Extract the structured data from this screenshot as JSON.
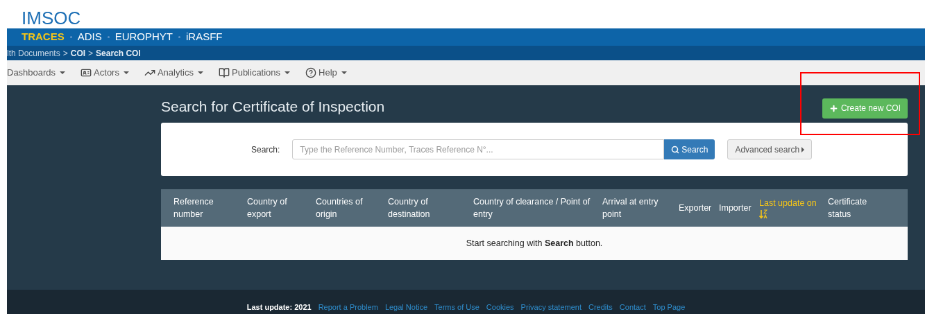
{
  "brand": "IMSOC",
  "apps": [
    {
      "label": "TRACES",
      "selected": true
    },
    {
      "label": "ADIS",
      "selected": false
    },
    {
      "label": "EUROPHYT",
      "selected": false
    },
    {
      "label": "iRASFF",
      "selected": false
    }
  ],
  "breadcrumb": {
    "separator": ">",
    "items": [
      {
        "label": "lth Documents",
        "bold": false
      },
      {
        "label": "COI",
        "bold": true
      },
      {
        "label": "Search COI",
        "bold": true
      }
    ]
  },
  "menu": [
    {
      "label": "Dashboards",
      "kind": "plain"
    },
    {
      "label": "Actors",
      "kind": "card"
    },
    {
      "label": "Analytics",
      "kind": "chart"
    },
    {
      "label": "Publications",
      "kind": "book"
    },
    {
      "label": "Help",
      "kind": "question"
    }
  ],
  "page_title": "Search for Certificate of Inspection",
  "create_button": "Create new COI",
  "search": {
    "label": "Search:",
    "placeholder": "Type the Reference Number, Traces Reference N°...",
    "button": "Search",
    "advanced": "Advanced search"
  },
  "table": {
    "columns": [
      {
        "label": "Reference number",
        "sorted": false
      },
      {
        "label": "Country of export",
        "sorted": false
      },
      {
        "label": "Countries of origin",
        "sorted": false
      },
      {
        "label": "Country of destination",
        "sorted": false
      },
      {
        "label": "Country of clearance / Point of entry",
        "sorted": false
      },
      {
        "label": "Arrival at entry point",
        "sorted": false
      },
      {
        "label": "Exporter",
        "sorted": false
      },
      {
        "label": "Importer",
        "sorted": false
      },
      {
        "label": "Last update on",
        "sorted": true
      },
      {
        "label": "Certificate status",
        "sorted": false
      }
    ],
    "empty_message": "Start searching with **Search** button."
  },
  "footer": {
    "text": "Last update: 2021",
    "links": [
      "Report a Problem",
      "Legal Notice",
      "Terms of Use",
      "Cookies",
      "Privacy statement",
      "Credits",
      "Contact",
      "Top Page"
    ]
  }
}
